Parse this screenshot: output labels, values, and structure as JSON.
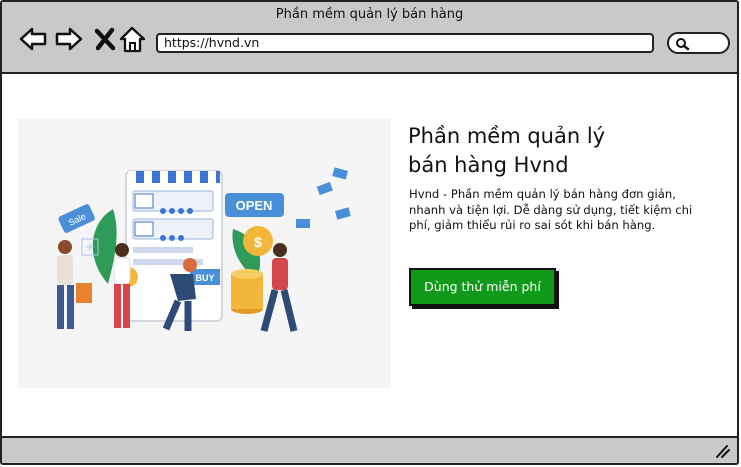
{
  "window": {
    "title": "Phần mềm quản lý bán hàng"
  },
  "browser": {
    "url": "https://hvnd.vn",
    "icons": [
      "back-arrow-icon",
      "forward-arrow-icon",
      "close-icon",
      "home-icon",
      "search-icon",
      "resize-grip-icon"
    ]
  },
  "hero": {
    "title_line1": "Phần mềm quản lý",
    "title_line2": "bán hàng Hvnd",
    "description": "Hvnd - Phần mềm quản lý bán hàng đơn giản, nhanh và tiện lợi. Dễ dàng sử dụng, tiết kiệm chi phí, giảm thiểu rủi ro sai sót khi bán hàng.",
    "cta_label": "Dùng thử miễn phí",
    "image": {
      "sale_tag": "Sale",
      "open_sign": "OPEN",
      "buy_label": "BUY"
    }
  },
  "colors": {
    "cta": "#119a19",
    "chrome": "#c9c9c9",
    "accent_blue": "#4a90d9"
  }
}
